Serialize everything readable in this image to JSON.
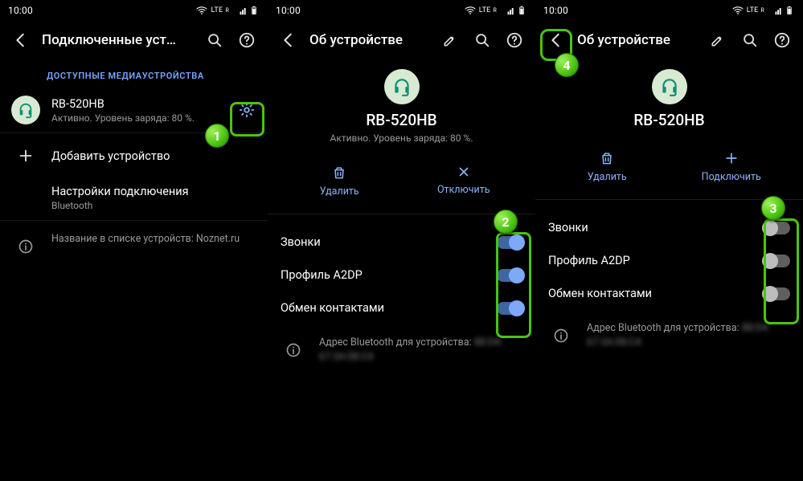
{
  "status": {
    "time": "10:00",
    "net_label": "LTE",
    "net_sup": "R"
  },
  "colors": {
    "accent": "#8ab4f8",
    "section": "#7aa8ff",
    "highlight": "#49c40f",
    "chip_bg": "#d9ead3",
    "chip_fg": "#0e8f77"
  },
  "panel1": {
    "title": "Подключенные уст…",
    "section": "ДОСТУПНЫЕ МЕДИАУСТРОЙСТВА",
    "device": {
      "name": "RB-520HB",
      "sub": "Активно. Уровень заряда: 80 %."
    },
    "add": "Добавить устройство",
    "pref": {
      "title": "Настройки подключения",
      "sub": "Bluetooth"
    },
    "footer": "Название в списке устройств: Noznet.ru"
  },
  "panel2": {
    "title": "Об устройстве",
    "device": {
      "name": "RB-520HB",
      "sub": "Активно. Уровень заряда: 80 %."
    },
    "actions": {
      "delete": "Удалить",
      "disconnect": "Отключить"
    },
    "settings": [
      {
        "label": "Звонки",
        "on": true
      },
      {
        "label": "Профиль A2DP",
        "on": true
      },
      {
        "label": "Обмен контактами",
        "on": true
      }
    ],
    "footer_label": "Адрес Bluetooth для устройства:",
    "footer_addr1": "88:D4:",
    "footer_addr2": "67:3A:08:C4"
  },
  "panel3": {
    "title": "Об устройстве",
    "device": {
      "name": "RB-520HB"
    },
    "actions": {
      "delete": "Удалить",
      "connect": "Подключить"
    },
    "settings": [
      {
        "label": "Звонки",
        "on": false
      },
      {
        "label": "Профиль A2DP",
        "on": false
      },
      {
        "label": "Обмен контактами",
        "on": false
      }
    ],
    "footer_label": "Адрес Bluetooth для устройства:",
    "footer_addr1": "88:D4:",
    "footer_addr2": "67:3A:08:C4"
  },
  "badges": {
    "1": "1",
    "2": "2",
    "3": "3",
    "4": "4"
  }
}
